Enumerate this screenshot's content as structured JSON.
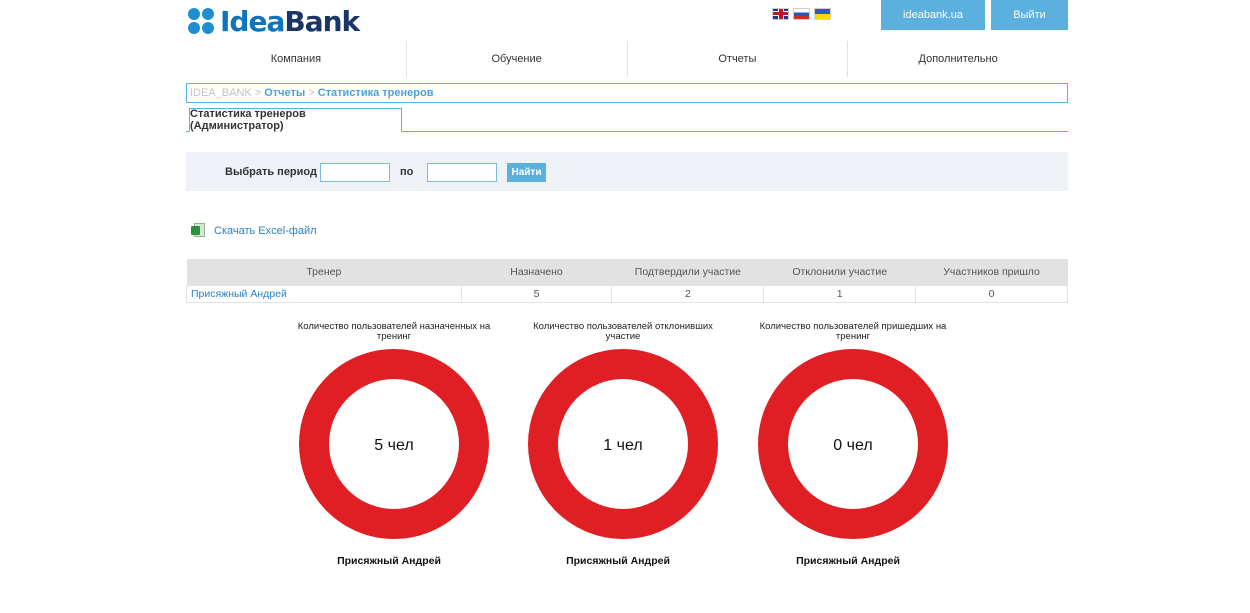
{
  "header": {
    "logo_idea": "Idea",
    "logo_bank": "Bank",
    "site_button": "ideabank.ua",
    "exit_button": "Выйти",
    "flags": [
      "flag-uk-icon",
      "flag-ru-icon",
      "flag-ua-icon"
    ]
  },
  "nav": [
    "Компания",
    "Обучение",
    "Отчеты",
    "Дополнительно"
  ],
  "breadcrumb": {
    "root": "IDEA_BANK",
    "sep": ">",
    "items": [
      "Отчеты",
      "Статистика тренеров"
    ]
  },
  "tab": "Статистика тренеров (Администратор)",
  "filter": {
    "label": "Выбрать период с",
    "to": "по",
    "from_value": "",
    "to_value": "",
    "button": "Найти"
  },
  "excel_link": "Скачать Excel-файл",
  "table": {
    "headers": [
      "Тренер",
      "Назначено",
      "Подтвердили участие",
      "Отклонили участие",
      "Участников пришло"
    ],
    "rows": [
      [
        "Присяжный Андрей",
        "5",
        "2",
        "1",
        "0"
      ]
    ]
  },
  "colors": {
    "accent": "#5bb0de",
    "ring": "#e01f24"
  },
  "chart_data": [
    {
      "type": "pie",
      "title": "Количество пользователей назначенных на тренинг",
      "center_label": "5 чел",
      "value": 5,
      "slices": [
        {
          "name": "Присяжный Андрей",
          "value": 5
        }
      ]
    },
    {
      "type": "pie",
      "title": "Количество пользователей отклонивших участие",
      "center_label": "1 чел",
      "value": 1,
      "slices": [
        {
          "name": "Присяжный Андрей",
          "value": 1
        }
      ]
    },
    {
      "type": "pie",
      "title": "Количество пользователей пришедших на тренинг",
      "center_label": "0 чел",
      "value": 0,
      "slices": [
        {
          "name": "Присяжный Андрей",
          "value": 0
        }
      ]
    }
  ]
}
